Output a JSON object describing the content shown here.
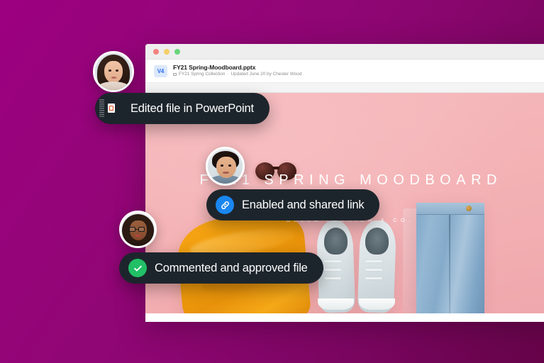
{
  "background": {
    "gradient_from": "#9c0080",
    "gradient_to": "#660449"
  },
  "window": {
    "traffic_lights": [
      {
        "name": "close",
        "color": "#f4817e"
      },
      {
        "name": "minimize",
        "color": "#f5ce68"
      },
      {
        "name": "maximize",
        "color": "#6bd57b"
      }
    ],
    "file": {
      "version_badge": "V4",
      "name": "FY21 Spring-Moodboard.pptx",
      "collection": "FY21 Spring Collection",
      "separator": "·",
      "updated": "Updated June 20 by Chester Wood"
    }
  },
  "slide": {
    "title": "FY21 SPRING MOODBOARD",
    "subtitle": "BELLA FASHION & CO.",
    "background_color": "#f2aeb2"
  },
  "notifications": [
    {
      "id": "powerpoint",
      "label": "Edited file in PowerPoint",
      "icon": "powerpoint-icon",
      "icon_color": "#e0481a"
    },
    {
      "id": "sharedlink",
      "label": "Enabled and shared link",
      "icon": "link-icon",
      "icon_color": "#1a86f0"
    },
    {
      "id": "commented",
      "label": "Commented and approved file",
      "icon": "check-circle-icon",
      "icon_color": "#21bf66"
    }
  ],
  "avatars": [
    {
      "id": "woman1",
      "name": "collaborator-avatar-1"
    },
    {
      "id": "man",
      "name": "collaborator-avatar-2"
    },
    {
      "id": "woman2",
      "name": "collaborator-avatar-3"
    }
  ]
}
